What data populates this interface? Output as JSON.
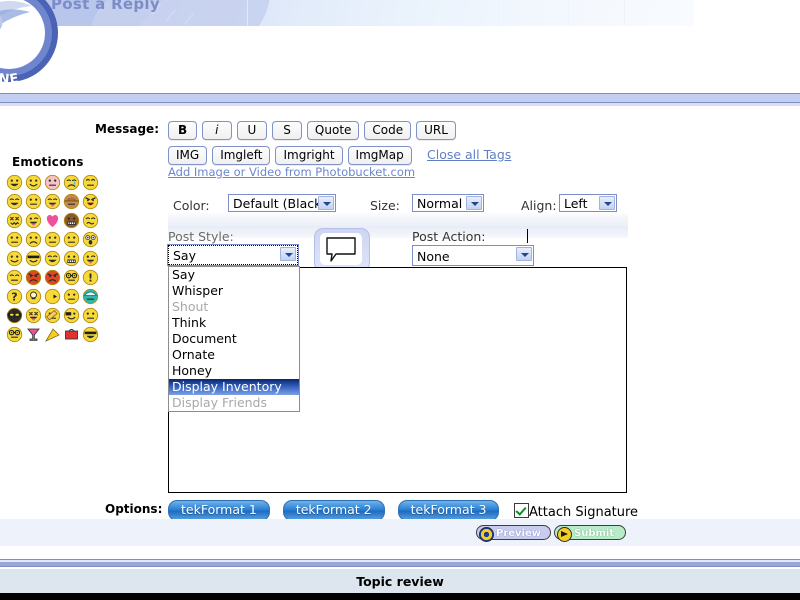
{
  "banner": {
    "title": "Post a Reply",
    "logo_text": "ONLINE"
  },
  "emoticons": {
    "title": "Emoticons",
    "rows": [
      [
        {
          "name": "emoticon-grin",
          "face": "#f7d93a",
          "mouth": "grin",
          "eyes": "dots"
        },
        {
          "name": "emoticon-smile",
          "face": "#f7d93a",
          "mouth": "smile",
          "eyes": "dots"
        },
        {
          "name": "emoticon-blush",
          "face": "#f6c2c6",
          "mouth": "flat",
          "eyes": "dots"
        },
        {
          "name": "emoticon-cry",
          "face": "#f7d93a",
          "mouth": "cry",
          "eyes": "closed"
        },
        {
          "name": "emoticon-roll-eyes",
          "face": "#f7d93a",
          "mouth": "flat",
          "eyes": "up"
        }
      ],
      [
        {
          "name": "emoticon-laugh",
          "face": "#f7d93a",
          "mouth": "grin",
          "eyes": "closed"
        },
        {
          "name": "emoticon-neutral",
          "face": "#f7d93a",
          "mouth": "flat",
          "eyes": "dots"
        },
        {
          "name": "emoticon-tongue",
          "face": "#f7d93a",
          "mouth": "tongue",
          "eyes": "closed"
        },
        {
          "name": "emoticon-hat",
          "face": "#c78a4e",
          "mouth": "flat",
          "eyes": "dots"
        },
        {
          "name": "emoticon-shout",
          "face": "#f7d93a",
          "mouth": "open",
          "eyes": "angry"
        }
      ],
      [
        {
          "name": "emoticon-swear",
          "face": "#f7d93a",
          "mouth": "zigzag",
          "eyes": "x"
        },
        {
          "name": "emoticon-wink-tongue",
          "face": "#f7d93a",
          "mouth": "tongue",
          "eyes": "wink"
        },
        {
          "name": "emoticon-heart",
          "face": "#f0509a",
          "mouth": "none",
          "eyes": "none"
        },
        {
          "name": "emoticon-box-head",
          "face": "#8b5a2b",
          "mouth": "teeth",
          "eyes": "dots"
        },
        {
          "name": "emoticon-dizzy",
          "face": "#f7d93a",
          "mouth": "wavy",
          "eyes": "closed"
        }
      ],
      [
        {
          "name": "emoticon-uneasy",
          "face": "#f7d93a",
          "mouth": "flat",
          "eyes": "dots"
        },
        {
          "name": "emoticon-sad",
          "face": "#f7d93a",
          "mouth": "frown",
          "eyes": "dots"
        },
        {
          "name": "emoticon-plain",
          "face": "#f7d93a",
          "mouth": "flat",
          "eyes": "dots"
        },
        {
          "name": "emoticon-confused",
          "face": "#f7d93a",
          "mouth": "flat",
          "eyes": "dots"
        },
        {
          "name": "emoticon-shocked",
          "face": "#f7d93a",
          "mouth": "o",
          "eyes": "wide"
        }
      ],
      [
        {
          "name": "emoticon-content",
          "face": "#f7d93a",
          "mouth": "smile",
          "eyes": "dots"
        },
        {
          "name": "emoticon-sunglasses",
          "face": "#f7d93a",
          "mouth": "smile",
          "eyes": "shades"
        },
        {
          "name": "emoticon-big-grin",
          "face": "#f7d93a",
          "mouth": "grin",
          "eyes": "closed"
        },
        {
          "name": "emoticon-grimace",
          "face": "#f7d93a",
          "mouth": "teeth",
          "eyes": "dots"
        },
        {
          "name": "emoticon-cheeky",
          "face": "#f7d93a",
          "mouth": "tongue",
          "eyes": "wink"
        }
      ],
      [
        {
          "name": "emoticon-sweat",
          "face": "#f7d93a",
          "mouth": "flat",
          "eyes": "closed"
        },
        {
          "name": "emoticon-devil-angry",
          "face": "#e0491f",
          "mouth": "frown",
          "eyes": "angry"
        },
        {
          "name": "emoticon-devil-mad",
          "face": "#e0491f",
          "mouth": "frown",
          "eyes": "angry"
        },
        {
          "name": "emoticon-nerd",
          "face": "#f7d93a",
          "mouth": "flat",
          "eyes": "glasses"
        },
        {
          "name": "emoticon-exclamation",
          "face": "#f7d93a",
          "mouth": "none",
          "eyes": "bang"
        }
      ],
      [
        {
          "name": "emoticon-question",
          "face": "#f7d93a",
          "mouth": "none",
          "eyes": "question"
        },
        {
          "name": "emoticon-idea",
          "face": "#f7d93a",
          "mouth": "none",
          "eyes": "bulb"
        },
        {
          "name": "emoticon-arrow",
          "face": "#f7d93a",
          "mouth": "none",
          "eyes": "arrow"
        },
        {
          "name": "emoticon-blank",
          "face": "#f7d93a",
          "mouth": "flat",
          "eyes": "dots"
        },
        {
          "name": "emoticon-alien",
          "face": "#2fb7ae",
          "mouth": "flat",
          "eyes": "dots"
        }
      ],
      [
        {
          "name": "emoticon-ninja",
          "face": "#2b2b2b",
          "mouth": "none",
          "eyes": "dots"
        },
        {
          "name": "emoticon-sick",
          "face": "#f7d93a",
          "mouth": "tongue",
          "eyes": "x"
        },
        {
          "name": "emoticon-bandage",
          "face": "#f7d93a",
          "mouth": "flat",
          "eyes": "dots"
        },
        {
          "name": "emoticon-pirate",
          "face": "#f7d93a",
          "mouth": "smile",
          "eyes": "patch"
        },
        {
          "name": "emoticon-thinking",
          "face": "#f7d93a",
          "mouth": "flat",
          "eyes": "dots"
        }
      ],
      [
        {
          "name": "emoticon-glasses",
          "face": "#f7d93a",
          "mouth": "flat",
          "eyes": "glasses"
        },
        {
          "name": "emoticon-cocktail",
          "face": "#f0509a",
          "mouth": "none",
          "eyes": "none"
        },
        {
          "name": "emoticon-party",
          "face": "#f2cf22",
          "mouth": "none",
          "eyes": "none"
        },
        {
          "name": "emoticon-toolbox",
          "face": "#e03030",
          "mouth": "none",
          "eyes": "none"
        },
        {
          "name": "emoticon-shades-grin",
          "face": "#f7d93a",
          "mouth": "grin",
          "eyes": "shades"
        }
      ]
    ]
  },
  "message": {
    "label": "Message:",
    "tag_buttons_row1": [
      {
        "name": "bold-button",
        "label": "B",
        "style": "b"
      },
      {
        "name": "italic-button",
        "label": "i",
        "style": "i"
      },
      {
        "name": "underline-button",
        "label": "U",
        "style": "u"
      },
      {
        "name": "strike-button",
        "label": "S",
        "style": "s"
      },
      {
        "name": "quote-button",
        "label": "Quote",
        "style": ""
      },
      {
        "name": "code-button",
        "label": "Code",
        "style": ""
      },
      {
        "name": "url-button",
        "label": "URL",
        "style": ""
      }
    ],
    "tag_buttons_row2": [
      {
        "name": "img-button",
        "label": "IMG",
        "style": ""
      },
      {
        "name": "imgleft-button",
        "label": "Imgleft",
        "style": ""
      },
      {
        "name": "imgright-button",
        "label": "Imgright",
        "style": ""
      },
      {
        "name": "imgmap-button",
        "label": "ImgMap",
        "style": ""
      }
    ],
    "close_all_tags": "Close all Tags",
    "photobucket_link": "Add Image or Video from Photobucket.com",
    "textarea_value": ""
  },
  "options_bar": {
    "color_label": "Color:",
    "color_value": "Default (Black)",
    "size_label": "Size:",
    "size_value": "Normal",
    "align_label": "Align:",
    "align_value": "Left"
  },
  "post_style": {
    "label": "Post Style:",
    "value": "Say",
    "options": [
      {
        "label": "Say",
        "state": "normal"
      },
      {
        "label": "Whisper",
        "state": "normal"
      },
      {
        "label": "Shout",
        "state": "disabled"
      },
      {
        "label": "Think",
        "state": "normal"
      },
      {
        "label": "Document",
        "state": "normal"
      },
      {
        "label": "Ornate",
        "state": "normal"
      },
      {
        "label": "Honey",
        "state": "normal"
      },
      {
        "label": "Display Inventory",
        "state": "selected"
      },
      {
        "label": "Display Friends",
        "state": "disabled"
      }
    ]
  },
  "post_action": {
    "label": "Post Action:",
    "value": "None"
  },
  "options_row": {
    "label": "Options:",
    "format_buttons": [
      {
        "name": "tekformat-1-button",
        "label": "tekFormat 1"
      },
      {
        "name": "tekformat-2-button",
        "label": "tekFormat 2"
      },
      {
        "name": "tekformat-3-button",
        "label": "tekFormat 3"
      }
    ],
    "attach_signature_label": "Attach Signature",
    "attach_signature_checked": true
  },
  "actions": {
    "preview_label": "Preview",
    "submit_label": "Submit"
  },
  "footer": {
    "topic_review": "Topic review"
  },
  "colors": {
    "accent_blue": "#7f8ec9",
    "banner_light": "#dfe8fa",
    "pill_blue": "#2b7fd4",
    "link_blue": "#5f7fc4",
    "selected_highlight": "#0a246a",
    "topic_review_bg": "#dde6ee"
  }
}
